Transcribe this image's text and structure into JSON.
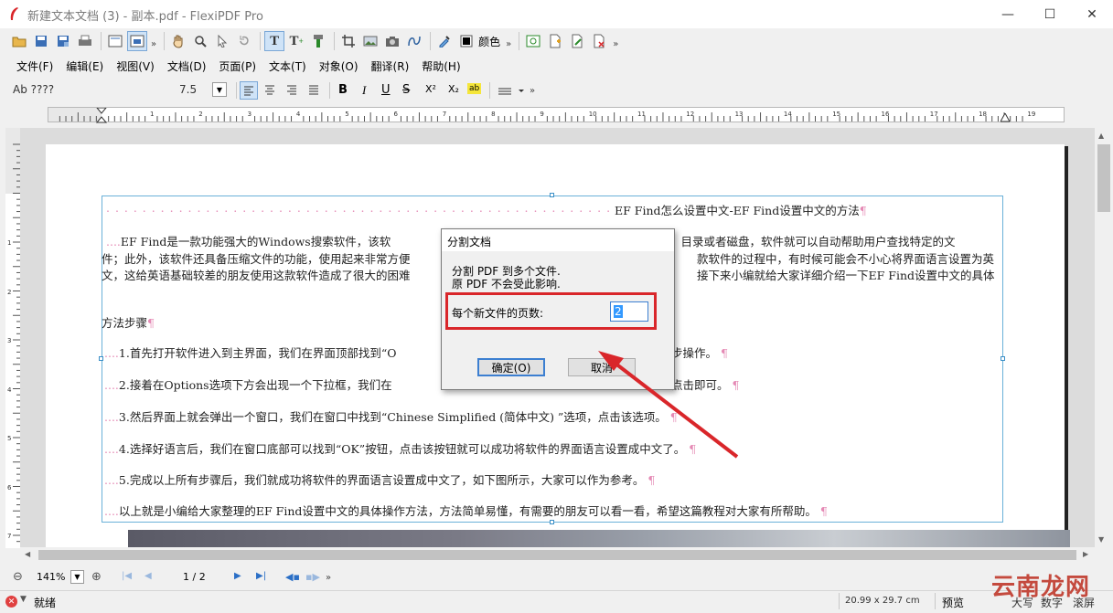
{
  "window": {
    "title": "新建文本文档 (3) - 副本.pdf - FlexiPDF Pro",
    "minimize": "—",
    "maximize": "☐",
    "close": "✕"
  },
  "toolbar": {
    "color_label": "颜色",
    "more": "»"
  },
  "menu": [
    "文件(F)",
    "编辑(E)",
    "视图(V)",
    "文档(D)",
    "页面(P)",
    "文本(T)",
    "对象(O)",
    "翻译(R)",
    "帮助(H)"
  ],
  "format": {
    "font_name": "Ab ????",
    "font_size": "7.5",
    "bold": "B",
    "italic": "I",
    "underline": "U",
    "strike": "S",
    "superscript": "X²",
    "subscript": "X₂",
    "highlight": "ab"
  },
  "ruler": {
    "h_ticks": [
      "1",
      "2",
      "3",
      "4",
      "5",
      "6",
      "7",
      "8",
      "9",
      "10",
      "11",
      "12",
      "13",
      "14",
      "15",
      "16",
      "17",
      "18",
      "19"
    ],
    "v_ticks": [
      "1",
      "2",
      "3",
      "4",
      "5",
      "6",
      "7"
    ]
  },
  "document": {
    "title_line": "EF Find怎么设置中文-EF Find设置中文的方法",
    "para1": [
      "EF Find是一款功能强大的Windows搜索软件，该软",
      "件；此外，该软件还具备压缩文件的功能，使用起来非常方便",
      "文，这给英语基础较差的朋友使用这款软件造成了很大的困难"
    ],
    "para1_right": [
      "，目录或者磁盘，软件就可以自动帮助用户查找特定的文",
      "款软件的过程中，有时候可能会不小心将界面语言设置为英",
      "接下来小编就给大家详细介绍一下EF Find设置中文的具体"
    ],
    "heading": "方法步骤",
    "steps": [
      {
        "left": "1.首先打开软件进入到主界面，我们在界面顶部找到“O",
        "right": "步操作。"
      },
      {
        "left": "2.接着在Options选项下方会出现一个下拉框，我们在",
        "right": "点击即可。"
      },
      {
        "left": "3.然后界面上就会弹出一个窗口，我们在窗口中找到“Chinese Simplified (简体中文) ”选项，点击该选项。",
        "right": ""
      },
      {
        "left": "4.选择好语言后，我们在窗口底部可以找到“OK”按钮，点击该按钮就可以成功将软件的界面语言设置成中文了。",
        "right": ""
      },
      {
        "left": "5.完成以上所有步骤后，我们就成功将软件的界面语言设置成中文了，如下图所示，大家可以作为参考。",
        "right": ""
      },
      {
        "left": "以上就是小编给大家整理的EF Find设置中文的具体操作方法，方法简单易懂，有需要的朋友可以看一看，希望这篇教程对大家有所帮助。",
        "right": ""
      }
    ],
    "pilcrow": "¶",
    "leader_dots": "....",
    "title_dots": ". . . . . . . . . . . . . . . . . . . . . . . . . . . . . . . . . . . . . . . . . . . . . . . . . . . . . . . . . . . ."
  },
  "dialog": {
    "title": "分割文档",
    "line1": "分割 PDF 到多个文件.",
    "line2": "原 PDF 不会受此影响.",
    "field_label": "每个新文件的页数:",
    "field_value": "2",
    "ok": "确定(O)",
    "cancel": "取消"
  },
  "nav": {
    "zoom": "141%",
    "page": "1 / 2",
    "more": "»"
  },
  "status": {
    "text": "就绪",
    "size": "20.99 x 29.7 cm",
    "mode": "预览",
    "caps": "大写",
    "num": "数字",
    "scroll": "滚屏"
  },
  "watermark": {
    "text": "云南龙网"
  },
  "colors": {
    "highlight_box": "#d9262a",
    "arrow": "#d9262a",
    "frame": "#6ab0d8",
    "pilcrow": "#e58ab5"
  }
}
